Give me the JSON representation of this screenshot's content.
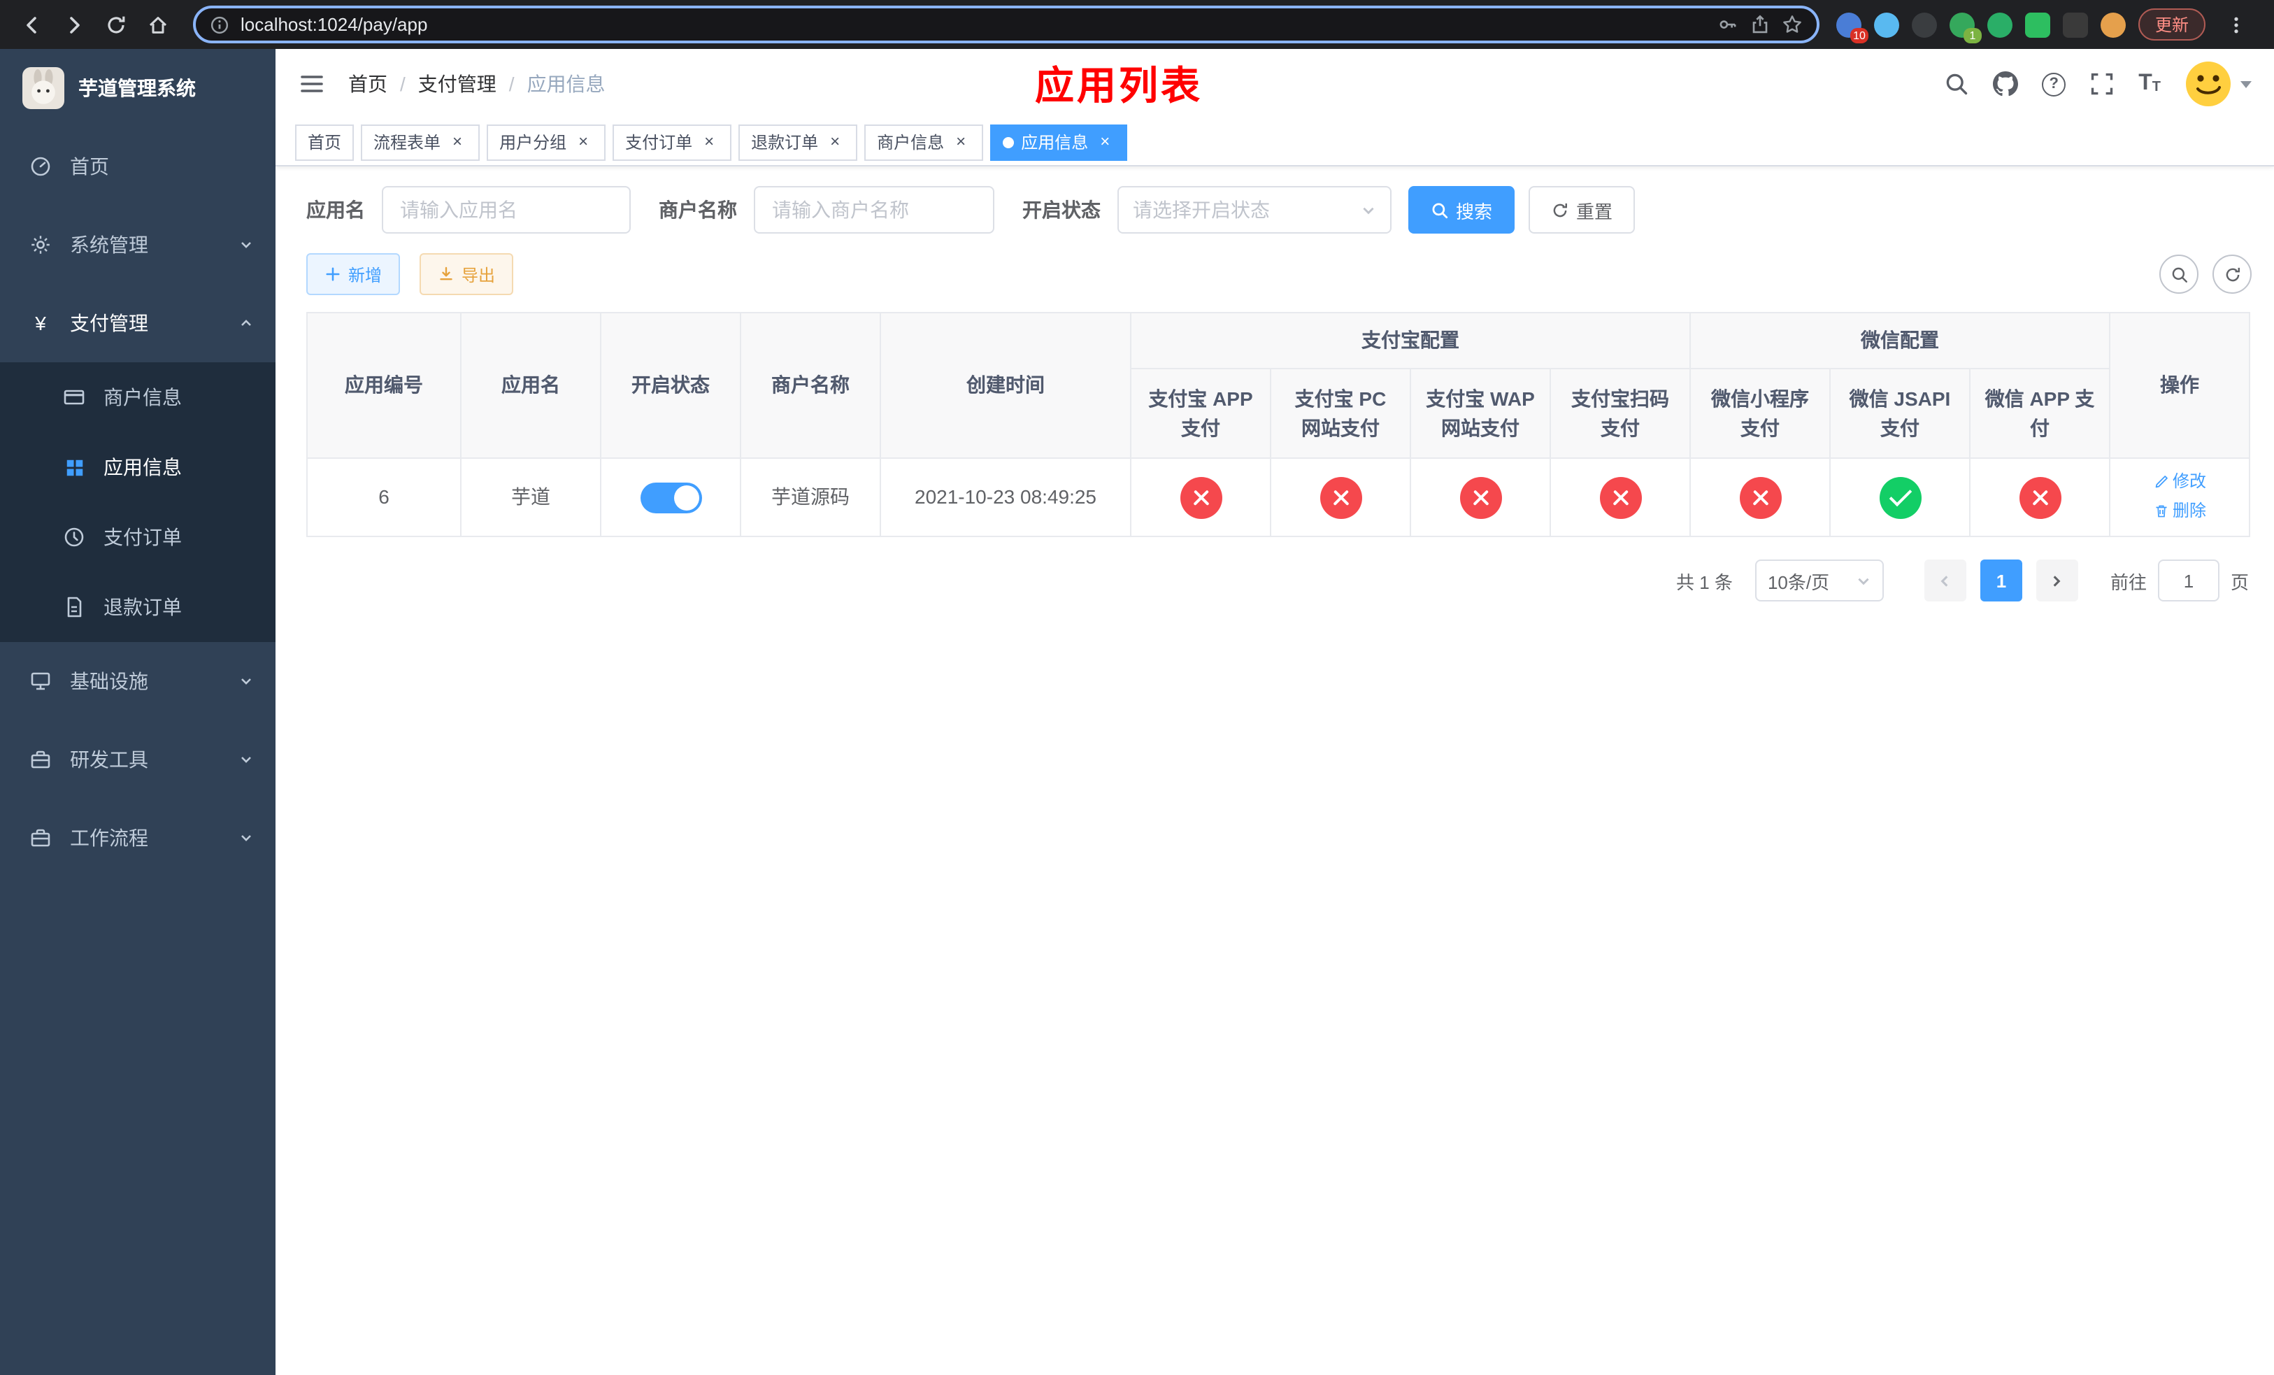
{
  "browser": {
    "url": "localhost:1024/pay/app",
    "update_label": "更新",
    "badges": {
      "extensions": "10",
      "profile": "1"
    }
  },
  "sidebar": {
    "logo_title": "芋道管理系统",
    "items": [
      {
        "label": "首页"
      },
      {
        "label": "系统管理",
        "expandable": true,
        "expanded": false
      },
      {
        "label": "支付管理",
        "expandable": true,
        "expanded": true,
        "children": [
          {
            "label": "商户信息",
            "active": false
          },
          {
            "label": "应用信息",
            "active": true
          },
          {
            "label": "支付订单",
            "active": false
          },
          {
            "label": "退款订单",
            "active": false
          }
        ]
      },
      {
        "label": "基础设施",
        "expandable": true,
        "expanded": false
      },
      {
        "label": "研发工具",
        "expandable": true,
        "expanded": false
      },
      {
        "label": "工作流程",
        "expandable": true,
        "expanded": false
      }
    ]
  },
  "navbar": {
    "breadcrumb": {
      "items": [
        "首页",
        "支付管理",
        "应用信息"
      ],
      "separator": "/"
    },
    "page_title": "应用列表"
  },
  "tabs": [
    {
      "label": "首页",
      "closable": false,
      "active": false
    },
    {
      "label": "流程表单",
      "closable": true,
      "active": false
    },
    {
      "label": "用户分组",
      "closable": true,
      "active": false
    },
    {
      "label": "支付订单",
      "closable": true,
      "active": false
    },
    {
      "label": "退款订单",
      "closable": true,
      "active": false
    },
    {
      "label": "商户信息",
      "closable": true,
      "active": false
    },
    {
      "label": "应用信息",
      "closable": true,
      "active": true
    }
  ],
  "filters": {
    "app_name": {
      "label": "应用名",
      "placeholder": "请输入应用名",
      "value": ""
    },
    "merchant_name": {
      "label": "商户名称",
      "placeholder": "请输入商户名称",
      "value": ""
    },
    "status": {
      "label": "开启状态",
      "placeholder": "请选择开启状态"
    },
    "search_label": "搜索",
    "reset_label": "重置"
  },
  "toolbar": {
    "add_label": "新增",
    "export_label": "导出"
  },
  "table": {
    "headers": {
      "app_id": "应用编号",
      "app_name": "应用名",
      "status": "开启状态",
      "merchant_name": "商户名称",
      "create_time": "创建时间",
      "alipay_group": "支付宝配置",
      "wechat_group": "微信配置",
      "alipay_app": "支付宝 APP 支付",
      "alipay_pc": "支付宝 PC 网站支付",
      "alipay_wap": "支付宝 WAP 网站支付",
      "alipay_qr": "支付宝扫码支付",
      "wx_lite": "微信小程序支付",
      "wx_jsapi": "微信 JSAPI 支付",
      "wx_app": "微信 APP 支付",
      "actions": "操作"
    },
    "rows": [
      {
        "app_id": "6",
        "app_name": "芋道",
        "enabled": true,
        "merchant_name": "芋道源码",
        "create_time": "2021-10-23 08:49:25",
        "alipay_app": false,
        "alipay_pc": false,
        "alipay_wap": false,
        "alipay_qr": false,
        "wx_lite": false,
        "wx_jsapi": true,
        "wx_app": false,
        "edit_label": "修改",
        "delete_label": "删除"
      }
    ]
  },
  "pagination": {
    "total_text": "共 1 条",
    "page_size": "10条/页",
    "current_page": "1",
    "goto_prefix": "前往",
    "goto_value": "1",
    "goto_suffix": "页"
  },
  "icons": {
    "close": "×",
    "question": "?",
    "yen": "¥",
    "font_size_large": "T",
    "font_size_small": "T"
  },
  "colors": {
    "accent": "#409eff",
    "success": "#13ce66",
    "danger": "#f5484d",
    "warning": "#e6a23c",
    "page_title": "#ff0000",
    "sidebar_bg": "#304156",
    "sidebar_submenu_bg": "#1f2d3d"
  }
}
